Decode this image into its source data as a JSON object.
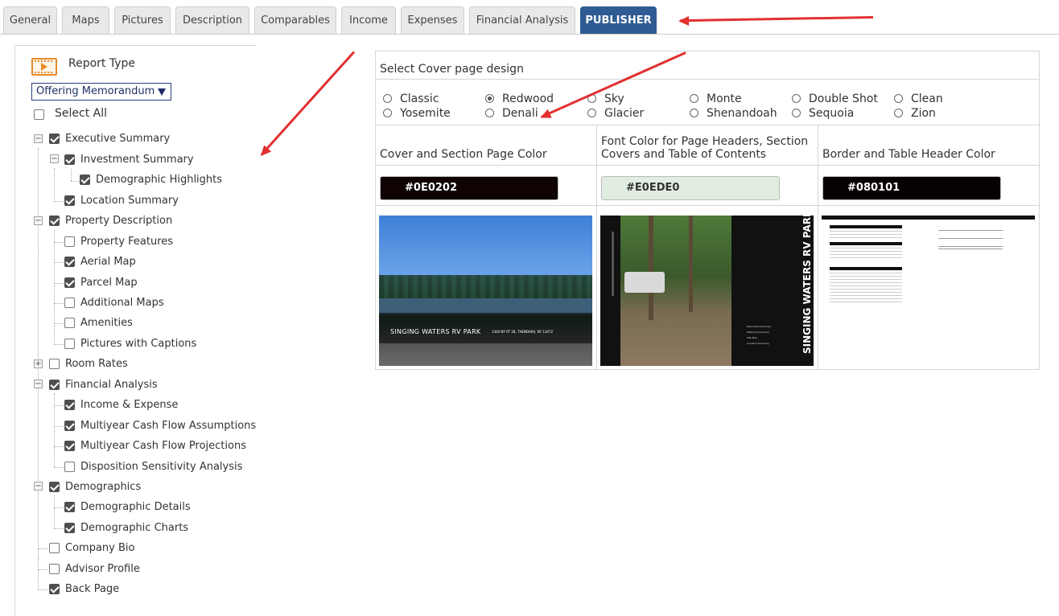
{
  "tabs": [
    "General",
    "Maps",
    "Pictures",
    "Description",
    "Comparables",
    "Income",
    "Expenses",
    "Financial Analysis",
    "PUBLISHER"
  ],
  "active_tab": "PUBLISHER",
  "left": {
    "report_type_label": "Report Type",
    "report_type_value": "Offering Memorandum",
    "select_all_label": "Select All",
    "tree": [
      {
        "label": "Executive Summary",
        "checked": true
      },
      {
        "label": "Investment Summary",
        "checked": true
      },
      {
        "label": "Demographic Highlights",
        "checked": true
      },
      {
        "label": "Location Summary",
        "checked": true
      },
      {
        "label": "Property Description",
        "checked": true
      },
      {
        "label": "Property Features",
        "checked": false
      },
      {
        "label": "Aerial Map",
        "checked": true
      },
      {
        "label": "Parcel Map",
        "checked": true
      },
      {
        "label": "Additional Maps",
        "checked": false
      },
      {
        "label": "Amenities",
        "checked": false
      },
      {
        "label": "Pictures with Captions",
        "checked": false
      },
      {
        "label": "Room Rates",
        "checked": false
      },
      {
        "label": "Financial Analysis",
        "checked": true
      },
      {
        "label": "Income & Expense",
        "checked": true
      },
      {
        "label": "Multiyear Cash Flow Assumptions",
        "checked": true
      },
      {
        "label": "Multiyear Cash Flow Projections",
        "checked": true
      },
      {
        "label": "Disposition Sensitivity Analysis",
        "checked": false
      },
      {
        "label": "Demographics",
        "checked": true
      },
      {
        "label": "Demographic Details",
        "checked": true
      },
      {
        "label": "Demographic Charts",
        "checked": true
      },
      {
        "label": "Company Bio",
        "checked": false
      },
      {
        "label": "Advisor Profile",
        "checked": false
      },
      {
        "label": "Back Page",
        "checked": true
      }
    ]
  },
  "cover": {
    "title": "Select Cover page design",
    "designs": [
      "Classic",
      "Redwood",
      "Sky",
      "Monte",
      "Double Shot",
      "Clean",
      "Yosemite",
      "Denali",
      "Glacier",
      "Shenandoah",
      "Sequoia",
      "Zion"
    ],
    "selected": "Redwood"
  },
  "colors": {
    "cover_section_label": "Cover and Section Page Color",
    "cover_section_value": "#0E0202",
    "font_label": "Font Color for Page Headers, Section Covers and Table of Contents",
    "font_value": "#E0EDE0",
    "border_label": "Border and Table Header Color",
    "border_value": "#080101"
  },
  "previews": {
    "redwood_name": "SINGING WATERS RV PARK",
    "redwood_address": "1304 NY RT 28, THENDARA, NY 13472",
    "denali_title": "SINGING WATERS RV PARK",
    "denali_toc": [
      "Executive Summary",
      "Offering Summary",
      "Site Plan",
      "Location Summary"
    ]
  }
}
